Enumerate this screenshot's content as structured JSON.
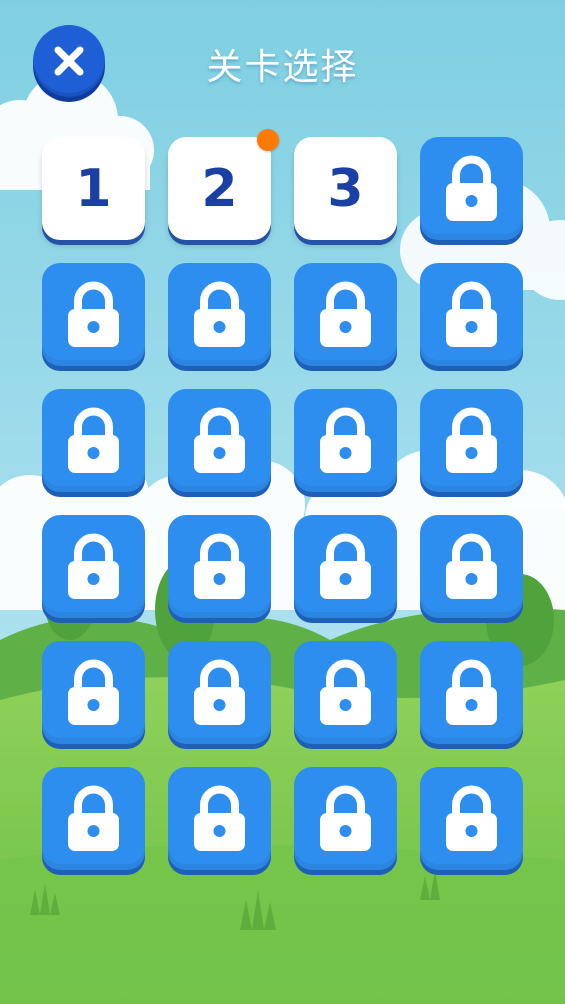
{
  "header": {
    "title": "关卡选择"
  },
  "levels": [
    {
      "label": "1",
      "locked": false,
      "badge": false
    },
    {
      "label": "2",
      "locked": false,
      "badge": true
    },
    {
      "label": "3",
      "locked": false,
      "badge": false
    },
    {
      "label": "",
      "locked": true,
      "badge": false
    },
    {
      "label": "",
      "locked": true,
      "badge": false
    },
    {
      "label": "",
      "locked": true,
      "badge": false
    },
    {
      "label": "",
      "locked": true,
      "badge": false
    },
    {
      "label": "",
      "locked": true,
      "badge": false
    },
    {
      "label": "",
      "locked": true,
      "badge": false
    },
    {
      "label": "",
      "locked": true,
      "badge": false
    },
    {
      "label": "",
      "locked": true,
      "badge": false
    },
    {
      "label": "",
      "locked": true,
      "badge": false
    },
    {
      "label": "",
      "locked": true,
      "badge": false
    },
    {
      "label": "",
      "locked": true,
      "badge": false
    },
    {
      "label": "",
      "locked": true,
      "badge": false
    },
    {
      "label": "",
      "locked": true,
      "badge": false
    },
    {
      "label": "",
      "locked": true,
      "badge": false
    },
    {
      "label": "",
      "locked": true,
      "badge": false
    },
    {
      "label": "",
      "locked": true,
      "badge": false
    },
    {
      "label": "",
      "locked": true,
      "badge": false
    },
    {
      "label": "",
      "locked": true,
      "badge": false
    },
    {
      "label": "",
      "locked": true,
      "badge": false
    },
    {
      "label": "",
      "locked": true,
      "badge": false
    },
    {
      "label": "",
      "locked": true,
      "badge": false
    }
  ],
  "icons": {
    "close": "close-icon",
    "lock": "lock-icon"
  },
  "colors": {
    "sky": "#8fd3e8",
    "grass": "#7cc44e",
    "tile_locked": "#2e8ef0",
    "tile_unlocked": "#ffffff",
    "number": "#1c3fa3",
    "badge": "#ff7a00",
    "close_button": "#1e5fd6"
  }
}
